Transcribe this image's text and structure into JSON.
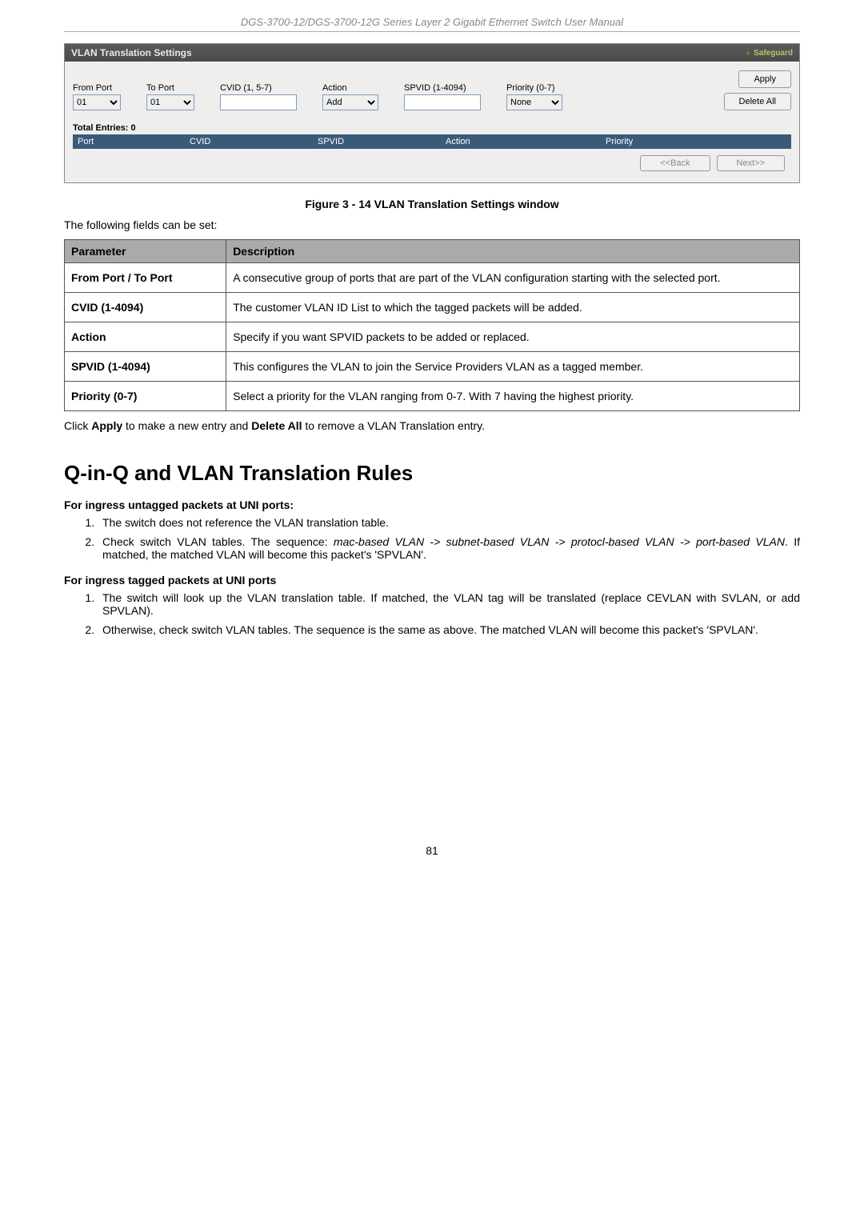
{
  "header": {
    "title": "DGS-3700-12/DGS-3700-12G Series Layer 2 Gigabit Ethernet Switch User Manual"
  },
  "panel": {
    "title": "VLAN Translation Settings",
    "safeguard": "Safeguard",
    "fromPortLabel": "From Port",
    "fromPortValue": "01",
    "toPortLabel": "To Port",
    "toPortValue": "01",
    "cvidLabel": "CVID (1, 5-7)",
    "cvidValue": "",
    "actionLabel": "Action",
    "actionValue": "Add",
    "spvidLabel": "SPVID (1-4094)",
    "spvidValue": "",
    "priorityLabel": "Priority (0-7)",
    "priorityValue": "None",
    "applyLabel": "Apply",
    "deleteAllLabel": "Delete All",
    "totalEntries": "Total Entries: 0",
    "cols": {
      "c1": "Port",
      "c2": "CVID",
      "c3": "SPVID",
      "c4": "Action",
      "c5": "Priority"
    },
    "backLabel": "<<Back",
    "nextLabel": "Next>>"
  },
  "figureCaption": "Figure 3 - 14 VLAN Translation Settings window",
  "introText": "The following fields can be set:",
  "paramTable": {
    "headParam": "Parameter",
    "headDesc": "Description",
    "rows": [
      {
        "label": "From Port / To Port",
        "desc": "A consecutive group of ports that are part of the VLAN configuration starting with the selected port."
      },
      {
        "label": "CVID (1-4094)",
        "desc": "The customer VLAN ID List to which the tagged packets will be added."
      },
      {
        "label": "Action",
        "desc": "Specify if you want SPVID packets to be added or replaced."
      },
      {
        "label": "SPVID (1-4094)",
        "desc": "This configures the VLAN to join the Service Providers VLAN as a tagged member."
      },
      {
        "label": "Priority (0-7)",
        "desc": "Select a priority for the VLAN ranging from 0-7. With 7 having the highest priority."
      }
    ]
  },
  "afterTable": {
    "click": "Click ",
    "apply": "Apply",
    "mid1": " to make a new entry and ",
    "deleteAll": "Delete All",
    "mid2": " to remove a VLAN Translation entry."
  },
  "sectionHeading": "Q-in-Q and VLAN Translation Rules",
  "sub1": "For ingress untagged packets at UNI ports:",
  "list1": {
    "i1": "The switch does not reference the VLAN translation table.",
    "i2a": "Check switch VLAN tables. The sequence: ",
    "i2b": "mac-based VLAN -> subnet-based VLAN -> protocl-based VLAN -> port-based VLAN",
    "i2c": ". If matched, the matched VLAN will become this packet's 'SPVLAN'."
  },
  "sub2": "For ingress tagged packets at UNI ports",
  "list2": {
    "i1": "The switch will look up the VLAN translation table. If matched, the VLAN tag will be translated (replace CEVLAN with SVLAN, or add SPVLAN).",
    "i2": "Otherwise, check switch VLAN tables. The sequence is the same as above. The matched VLAN will become this packet's 'SPVLAN'."
  },
  "pageNumber": "81"
}
